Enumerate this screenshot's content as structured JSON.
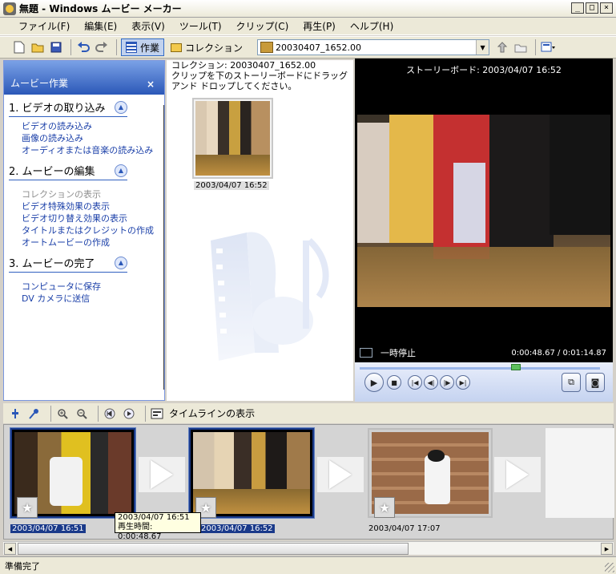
{
  "window": {
    "title": "無題 - Windows ムービー メーカー",
    "min_glyph": "_",
    "max_glyph": "□",
    "close_glyph": "×"
  },
  "menu": [
    "ファイル(F)",
    "編集(E)",
    "表示(V)",
    "ツール(T)",
    "クリップ(C)",
    "再生(P)",
    "ヘルプ(H)"
  ],
  "toolbar": {
    "tasks_label": "作業",
    "collections_label": "コレクション",
    "collection_select": "20030407_1652.00"
  },
  "taskpane": {
    "title": "ムービー作業",
    "close_glyph": "×",
    "sections": [
      {
        "heading": "1. ビデオの取り込み",
        "links": [
          "ビデオの読み込み",
          "画像の読み込み",
          "オーディオまたは音楽の読み込み"
        ]
      },
      {
        "heading": "2. ムービーの編集",
        "links": [
          "コレクションの表示",
          "ビデオ特殊効果の表示",
          "ビデオ切り替え効果の表示",
          "タイトルまたはクレジットの作成",
          "オートムービーの作成"
        ]
      },
      {
        "heading": "3. ムービーの完了",
        "links": [
          "コンピュータに保存",
          "DV カメラに送信"
        ]
      }
    ]
  },
  "collection": {
    "title": "コレクション: 20030407_1652.00",
    "hint": "クリップを下のストーリーボードにドラッグ アンド ドロップしてください。",
    "clip_caption": "2003/04/07 16:52"
  },
  "monitor": {
    "title": "ストーリーボード: 2003/04/07 16:52",
    "state": "一時停止",
    "time": "0:00:48.67 / 0:01:14.87",
    "progress": 0.65,
    "accent_color": "#5cc05c"
  },
  "storyboard": {
    "show_timeline_label": "タイムラインの表示",
    "clips": [
      {
        "label": "2003/04/07 16:51",
        "selected": true
      },
      {
        "label": "2003/04/07 16:52",
        "selected": true
      },
      {
        "label": "2003/04/07 17:07",
        "selected": false
      }
    ],
    "tooltip": {
      "line1": "2003/04/07 16:51",
      "line2": "再生時間:  0:00:48.67"
    }
  },
  "status": {
    "text": "準備完了"
  }
}
